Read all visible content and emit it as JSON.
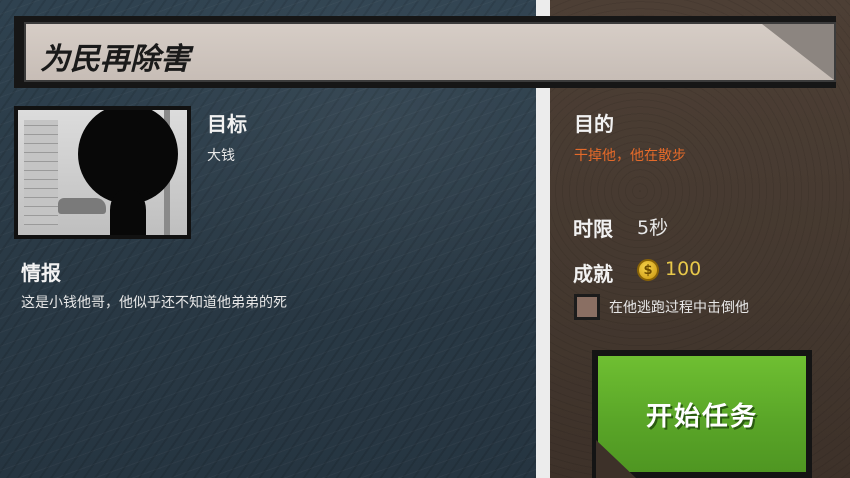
{
  "mission": {
    "title": "为民再除害"
  },
  "target": {
    "label": "目标",
    "name": "大钱"
  },
  "intel": {
    "label": "情报",
    "text": "这是小钱他哥，他似乎还不知道他弟弟的死"
  },
  "objective": {
    "label": "目的",
    "text": "干掉他，他在散步",
    "color": "#e46a2a"
  },
  "time_limit": {
    "label": "时限",
    "value": "5秒"
  },
  "achievement": {
    "label": "成就",
    "coin_icon": "coin-icon",
    "coin_symbol": "$",
    "reward": "100",
    "condition": "在他逃跑过程中击倒他",
    "checked": false
  },
  "start_button": {
    "label": "开始任务",
    "color": "#5aa628"
  }
}
